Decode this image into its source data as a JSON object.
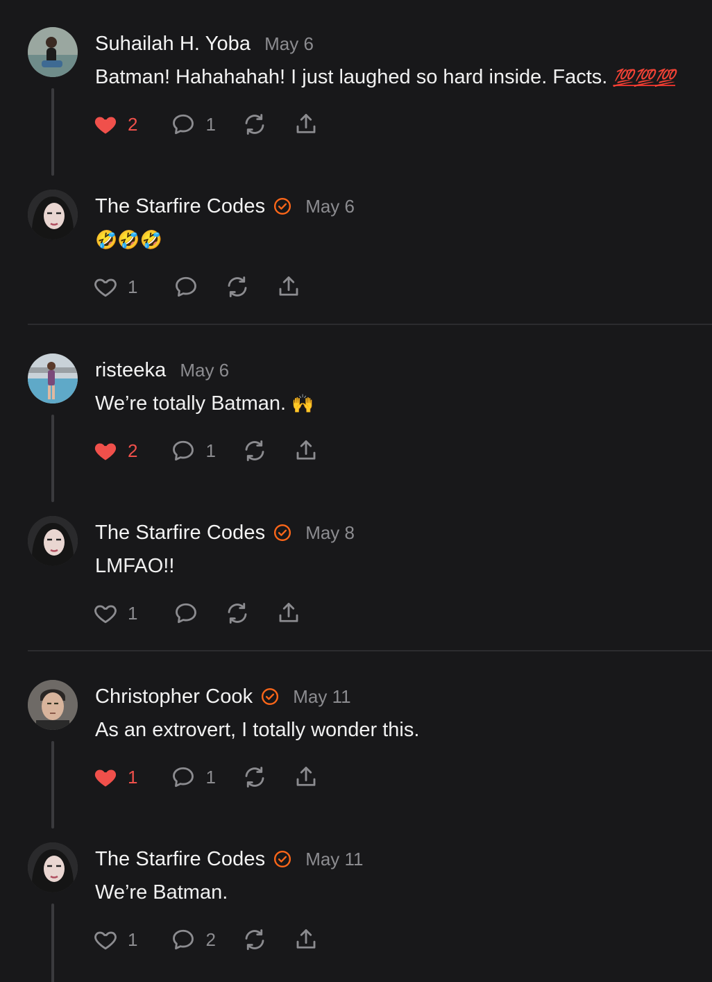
{
  "comments": [
    {
      "author": "Suhailah H. Yoba",
      "verified": false,
      "date": "May 6",
      "text": "Batman! Hahahahah! I just laughed so hard inside. Facts.",
      "trailing_emoji": "💯💯💯",
      "liked": true,
      "likes": "2",
      "replies": "1",
      "avatar_icon": "person-photo-avatar"
    },
    {
      "author": "The Starfire Codes",
      "verified": true,
      "date": "May 6",
      "text": "",
      "trailing_emoji": "🤣🤣🤣",
      "liked": false,
      "likes": "1",
      "replies": "",
      "avatar_icon": "person-photo-avatar"
    },
    {
      "author": "risteeka",
      "verified": false,
      "date": "May 6",
      "text": "We’re totally Batman.",
      "trailing_emoji": "🙌",
      "liked": true,
      "likes": "2",
      "replies": "1",
      "avatar_icon": "person-photo-avatar"
    },
    {
      "author": "The Starfire Codes",
      "verified": true,
      "date": "May 8",
      "text": "LMFAO!!",
      "trailing_emoji": "",
      "liked": false,
      "likes": "1",
      "replies": "",
      "avatar_icon": "person-photo-avatar"
    },
    {
      "author": "Christopher Cook",
      "verified": true,
      "date": "May 11",
      "text": "As an extrovert, I totally wonder this.",
      "trailing_emoji": "",
      "liked": true,
      "likes": "1",
      "replies": "1",
      "avatar_icon": "person-photo-avatar"
    },
    {
      "author": "The Starfire Codes",
      "verified": true,
      "date": "May 11",
      "text": "We’re Batman.",
      "trailing_emoji": "",
      "liked": false,
      "likes": "1",
      "replies": "2",
      "avatar_icon": "person-photo-avatar"
    }
  ],
  "icons": {
    "like": "heart-icon",
    "reply": "comment-bubble-icon",
    "restack": "restack-icon",
    "share": "share-icon",
    "verified": "verified-check-icon"
  },
  "colors": {
    "background": "#18181a",
    "liked": "#f0504b",
    "verified": "#ff6719",
    "muted": "#8c8c90"
  }
}
